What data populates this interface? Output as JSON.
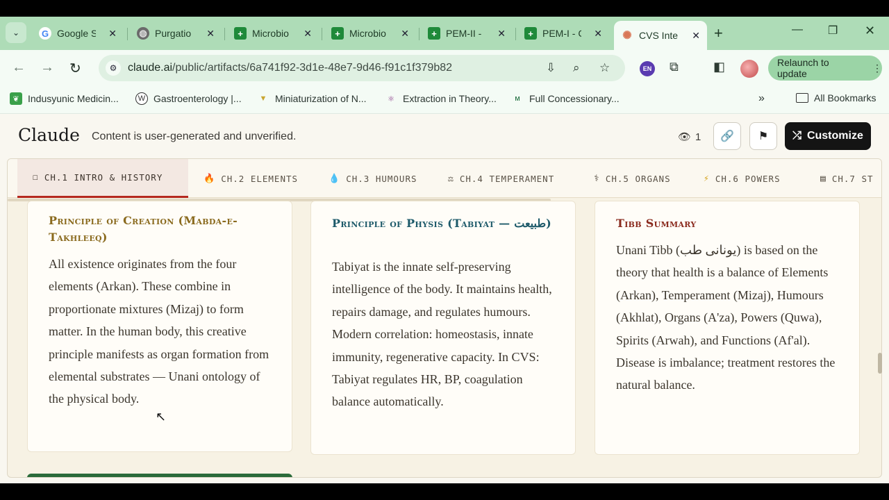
{
  "browser": {
    "tabs": [
      {
        "title": "Google S",
        "icon": "google-icon"
      },
      {
        "title": "Purgatio",
        "icon": "globe-icon"
      },
      {
        "title": "Microbio",
        "icon": "plus-cross-icon"
      },
      {
        "title": "Microbio",
        "icon": "plus-cross-icon"
      },
      {
        "title": "PEM-II -",
        "icon": "plus-cross-icon"
      },
      {
        "title": "PEM-I - C",
        "icon": "plus-cross-icon"
      },
      {
        "title": "CVS Inte",
        "icon": "claude-icon"
      }
    ],
    "url_host": "claude.ai",
    "url_path": "/public/artifacts/6a741f92-3d1e-48e7-9d46-f91c1f379b82",
    "extension_badge": "EN",
    "relaunch_label": "Relaunch to update",
    "bookmarks": [
      "Indusyunic Medicin...",
      "Gastroenterology |...",
      "Miniaturization of N...",
      "Extraction in Theory...",
      "Full Concessionary..."
    ],
    "all_bookmarks_label": "All Bookmarks",
    "accent": "#aedcb7"
  },
  "header": {
    "logo": "Claude",
    "note": "Content is user-generated and unverified.",
    "views": "1",
    "customize_label": "Customize"
  },
  "chapters": [
    {
      "label": "CH.1 INTRO & HISTORY",
      "icon": "book-icon"
    },
    {
      "label": "CH.2 ELEMENTS",
      "icon": "fire-icon"
    },
    {
      "label": "CH.3 HUMOURS",
      "icon": "drop-icon"
    },
    {
      "label": "CH.4 TEMPERAMENT",
      "icon": "brain-icon"
    },
    {
      "label": "CH.5 ORGANS",
      "icon": "organ-icon"
    },
    {
      "label": "CH.6 POWERS",
      "icon": "lightning-icon"
    },
    {
      "label": "CH.7 ST",
      "icon": "scroll-icon"
    }
  ],
  "cards": [
    {
      "title": "Principle of Creation (Mabda-e-Takhleeq)",
      "body": "All existence originates from the four elements (Arkan). These combine in proportionate mixtures (Mizaj) to form matter. In the human body, this creative principle manifests as organ formation from elemental substrates — Unani ontology of the physical body."
    },
    {
      "title": "Principle of Physis (Tabiyat — طبیعت)",
      "body": "Tabiyat is the innate self-preserving intelligence of the body. It maintains health, repairs damage, and regulates humours. Modern correlation: homeostasis, innate immunity, regenerative capacity. In CVS: Tabiyat regulates HR, BP, coagulation balance automatically."
    },
    {
      "title": "Tibb Summary",
      "body": "Unani Tibb (یونانی طب) is based on the theory that health is a balance of Elements (Arkan), Temperament (Mizaj), Humours (Akhlat), Organs (A'za), Powers (Quwa), Spirits (Arwah), and Functions (Af'al). Disease is imbalance; treatment restores the natural balance."
    }
  ],
  "colors": {
    "card1_title": "#8a6a1e",
    "card2_title": "#1d5a6a",
    "card3_title": "#8a2a1e",
    "active_chapter_border": "#b5281e"
  }
}
